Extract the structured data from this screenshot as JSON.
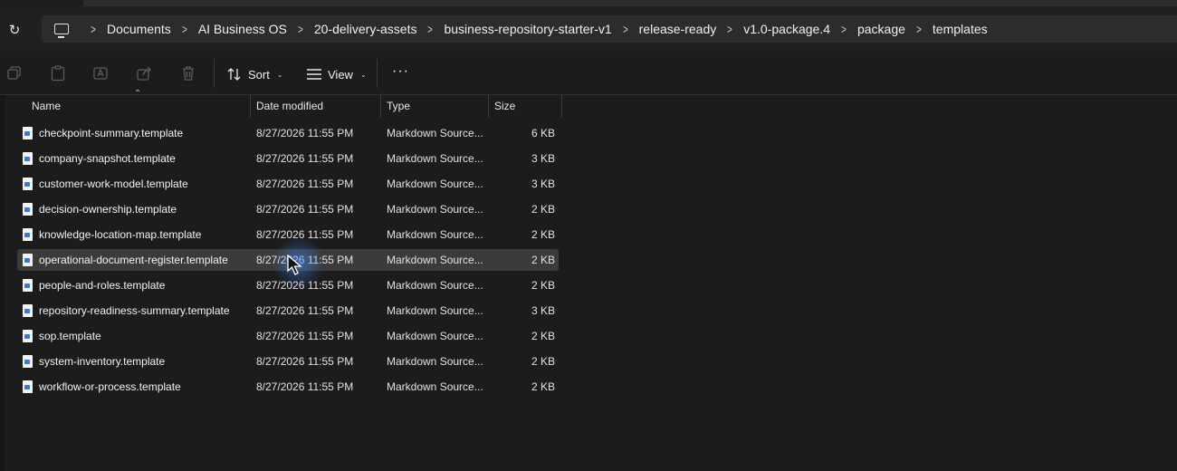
{
  "address_bar": {
    "refresh_icon": "refresh-icon",
    "root_icon": "computer-icon",
    "breadcrumbs": [
      "Documents",
      "AI Business OS",
      "20-delivery-assets",
      "business-repository-starter-v1",
      "release-ready",
      "v1.0-package.4",
      "package",
      "templates"
    ]
  },
  "toolbar": {
    "icons": [
      "copy-icon",
      "paste-icon",
      "rename-icon",
      "share-icon",
      "delete-icon"
    ],
    "sort_label": "Sort",
    "view_label": "View",
    "more_label": "···"
  },
  "columns": {
    "name": "Name",
    "date": "Date modified",
    "type": "Type",
    "size": "Size"
  },
  "files": [
    {
      "name": "checkpoint-summary.template",
      "date": "8/27/2026 11:55 PM",
      "type": "Markdown Source...",
      "size": "6 KB",
      "selected": false
    },
    {
      "name": "company-snapshot.template",
      "date": "8/27/2026 11:55 PM",
      "type": "Markdown Source...",
      "size": "3 KB",
      "selected": false
    },
    {
      "name": "customer-work-model.template",
      "date": "8/27/2026 11:55 PM",
      "type": "Markdown Source...",
      "size": "3 KB",
      "selected": false
    },
    {
      "name": "decision-ownership.template",
      "date": "8/27/2026 11:55 PM",
      "type": "Markdown Source...",
      "size": "2 KB",
      "selected": false
    },
    {
      "name": "knowledge-location-map.template",
      "date": "8/27/2026 11:55 PM",
      "type": "Markdown Source...",
      "size": "2 KB",
      "selected": false
    },
    {
      "name": "operational-document-register.template",
      "date": "8/27/2026 11:55 PM",
      "type": "Markdown Source...",
      "size": "2 KB",
      "selected": true
    },
    {
      "name": "people-and-roles.template",
      "date": "8/27/2026 11:55 PM",
      "type": "Markdown Source...",
      "size": "2 KB",
      "selected": false
    },
    {
      "name": "repository-readiness-summary.template",
      "date": "8/27/2026 11:55 PM",
      "type": "Markdown Source...",
      "size": "3 KB",
      "selected": false
    },
    {
      "name": "sop.template",
      "date": "8/27/2026 11:55 PM",
      "type": "Markdown Source...",
      "size": "2 KB",
      "selected": false
    },
    {
      "name": "system-inventory.template",
      "date": "8/27/2026 11:55 PM",
      "type": "Markdown Source...",
      "size": "2 KB",
      "selected": false
    },
    {
      "name": "workflow-or-process.template",
      "date": "8/27/2026 11:55 PM",
      "type": "Markdown Source...",
      "size": "2 KB",
      "selected": false
    }
  ],
  "colors": {
    "background": "#1c1c1c",
    "selection": "#3b3b3b",
    "file_icon_accent": "#2f7ae0"
  }
}
